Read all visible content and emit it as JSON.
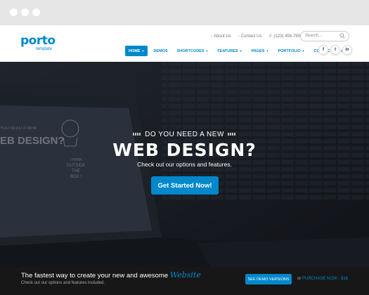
{
  "browser": {
    "dots": 3
  },
  "logo": {
    "name": "porto",
    "sub": "template"
  },
  "toplinks": [
    {
      "label": "About Us",
      "icon": "chevron-right-icon"
    },
    {
      "label": "Contact Us",
      "icon": "chevron-right-icon"
    },
    {
      "label": "(123) 456-789",
      "icon": "phone-icon"
    }
  ],
  "search": {
    "placeholder": "Search..."
  },
  "nav": [
    {
      "label": "HOME",
      "caret": true,
      "active": true
    },
    {
      "label": "DEMOS",
      "caret": false,
      "active": false
    },
    {
      "label": "SHORTCODES",
      "caret": true,
      "active": false
    },
    {
      "label": "FEATURES",
      "caret": true,
      "active": false
    },
    {
      "label": "PAGES",
      "caret": true,
      "active": false
    },
    {
      "label": "PORTFOLIO",
      "caret": true,
      "active": false
    },
    {
      "label": "CONTACT US",
      "caret": true,
      "active": false
    }
  ],
  "social": [
    {
      "label": "f",
      "icon": "facebook-icon"
    },
    {
      "label": "t",
      "icon": "twitter-icon"
    },
    {
      "label": "in",
      "icon": "linkedin-icon"
    }
  ],
  "hero": {
    "kicker": "DO YOU NEED A NEW",
    "headline": "WEB DESIGN?",
    "sub": "Check out our options and features.",
    "cta": "Get Started Now!",
    "screen": {
      "headline_part": "EB DESIGN?",
      "kicker_part": "YOU NEED A NEW",
      "sketch": [
        "THINK",
        "OUTSIDE",
        "THE",
        "BOX !"
      ]
    }
  },
  "footer": {
    "tagline": "The fastest way to create your new and awesome",
    "tagline_em": "Website",
    "sub": "Check out our options and features included.",
    "demo_button": "SEE DEMO VERSIONS",
    "or": "or",
    "purchase": "PURCHASE NOW - $16"
  },
  "colors": {
    "brand": "#0088cc",
    "footer": "#171717",
    "chrome": "#e6e6e6"
  }
}
